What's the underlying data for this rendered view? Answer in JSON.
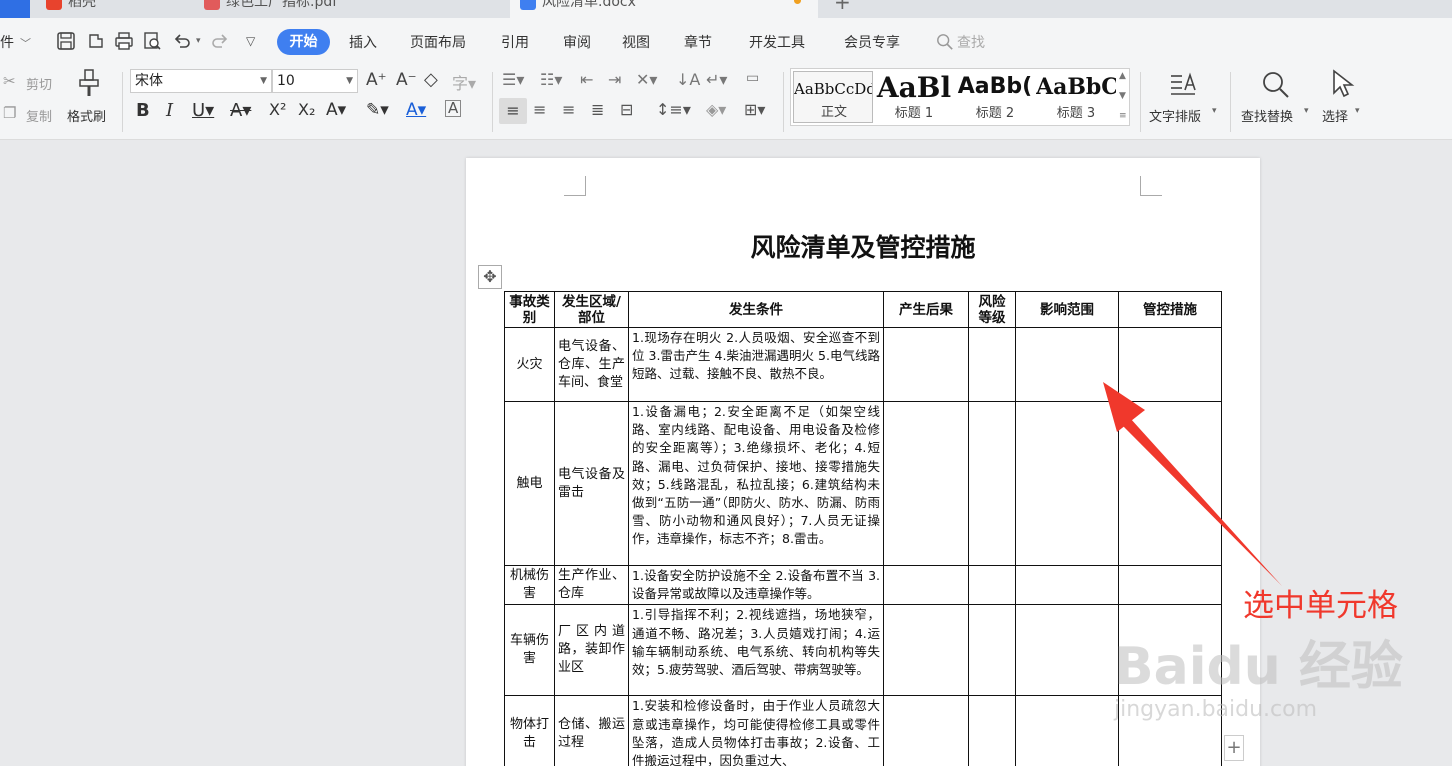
{
  "tabs": [
    {
      "label": "稻壳",
      "icon_color": "#e8432d"
    },
    {
      "label": "绿色工厂指标.pdf",
      "icon_color": "#e15b5b"
    },
    {
      "label": "风险清单.docx",
      "icon_color": "#3f7ff0"
    }
  ],
  "menubar": {
    "file_label": "件",
    "start": "开始",
    "items": [
      "插入",
      "页面布局",
      "引用",
      "审阅",
      "视图",
      "章节",
      "开发工具",
      "会员专享"
    ],
    "search_label": "查找"
  },
  "ribbon": {
    "cut": "剪切",
    "copy": "复制",
    "format_painter": "格式刷",
    "font_name": "宋体",
    "font_size": "10",
    "styles": [
      {
        "sample": "AaBbCcDd",
        "name": "正文"
      },
      {
        "sample": "AaBl",
        "name": "标题 1"
      },
      {
        "sample": "AaBb(",
        "name": "标题 2"
      },
      {
        "sample": "AaBbC",
        "name": "标题 3"
      }
    ],
    "text_layout": "文字排版",
    "find_replace": "查找替换",
    "select": "选择"
  },
  "document": {
    "title": "风险清单及管控措施",
    "headers": [
      "事故类别",
      "发生区域/部位",
      "发生条件",
      "产生后果",
      "风险等级",
      "影响范围",
      "管控措施"
    ],
    "rows": [
      {
        "category": "火灾",
        "area": "电气设备、仓库、生产车间、食堂",
        "condition": "1.现场存在明火 2.人员吸烟、安全巡查不到位 3.雷击产生 4.柴油泄漏遇明火 5.电气线路短路、过载、接触不良、散热不良。"
      },
      {
        "category": "触电",
        "area": "电气设备及雷击",
        "condition": "1.设备漏电；2.安全距离不足（如架空线路、室内线路、配电设备、用电设备及检修的安全距离等）；3.绝缘损坏、老化；4.短路、漏电、过负荷保护、接地、接零措施失效；5.线路混乱，私拉乱接；6.建筑结构未做到“五防一通”（即防火、防水、防漏、防雨雪、防小动物和通风良好）；7.人员无证操作，违章操作，标志不齐；8.雷击。"
      },
      {
        "category": "机械伤害",
        "area": "生产作业、仓库",
        "condition": "1.设备安全防护设施不全 2.设备布置不当 3.设备异常或故障以及违章操作等。"
      },
      {
        "category": "车辆伤害",
        "area": "厂区内道路，装卸作业区",
        "condition": "1.引导指挥不利；2.视线遮挡，场地狭窄，通道不畅、路况差；3.人员嬉戏打闹；4.运输车辆制动系统、电气系统、转向机构等失效；5.疲劳驾驶、酒后驾驶、带病驾驶等。"
      },
      {
        "category": "物体打击",
        "area": "仓储、搬运过程",
        "condition": "1.安装和检修设备时，由于作业人员疏忽大意或违章操作，均可能使得检修工具或零件坠落，造成人员物体打击事故；2.设备、工件搬运过程中，因负重过大、"
      }
    ]
  },
  "annotation": {
    "label": "选中单元格",
    "color": "#f0382c"
  },
  "watermark": {
    "logo": "Baidu 经验",
    "url": "jingyan.baidu.com"
  }
}
